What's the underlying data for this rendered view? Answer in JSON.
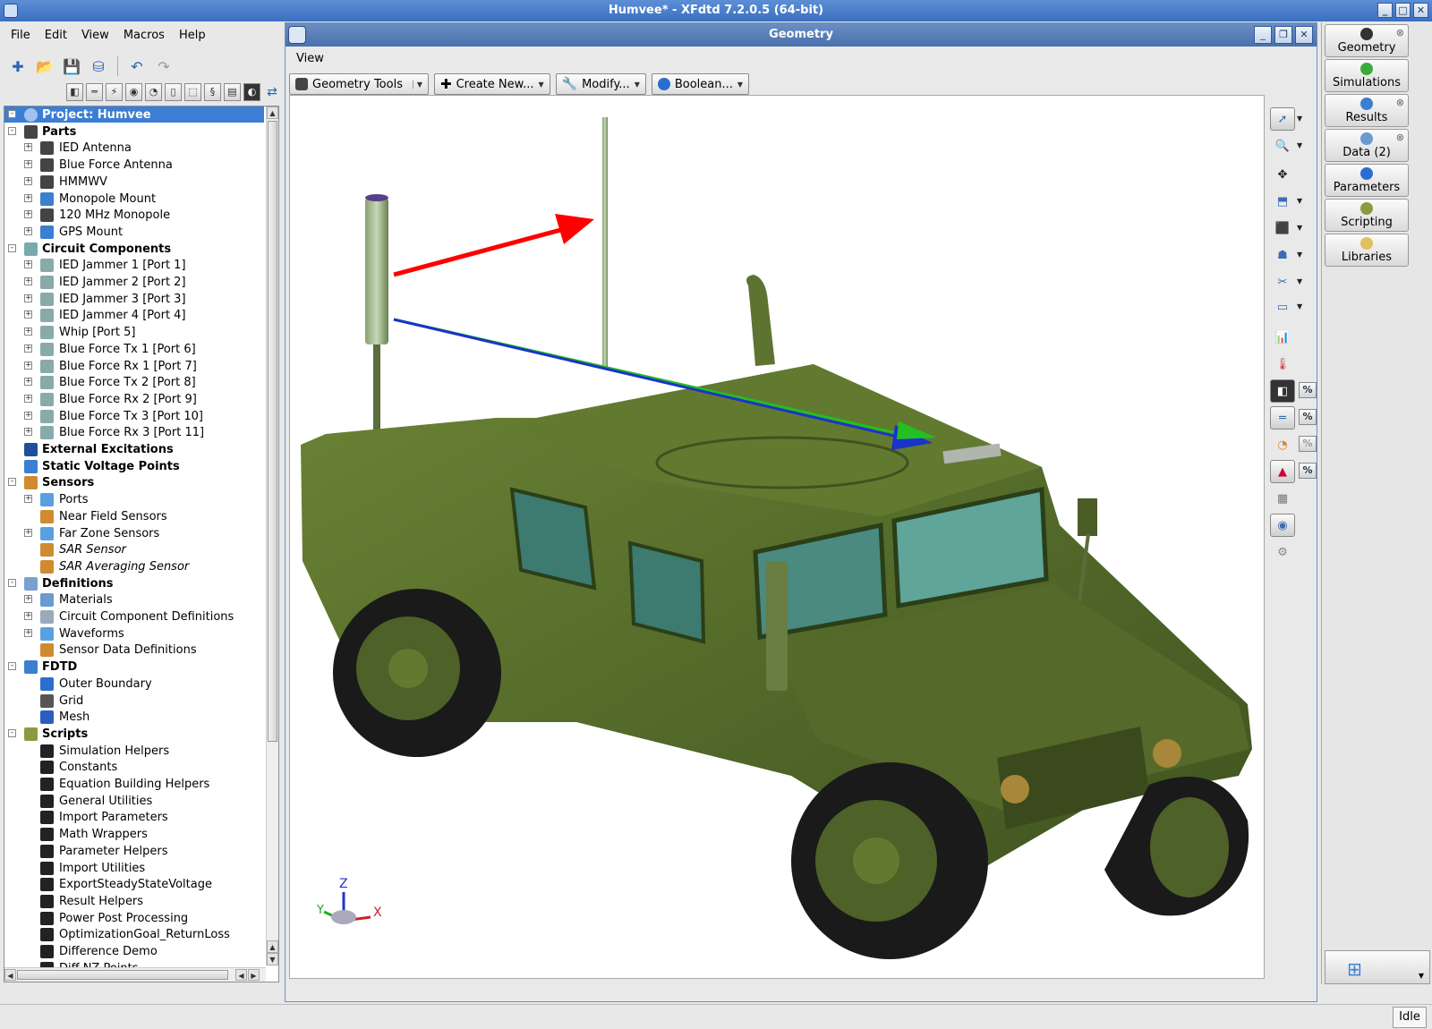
{
  "window": {
    "title": "Humvee* - XFdtd 7.2.0.5 (64-bit)"
  },
  "menu": [
    "File",
    "Edit",
    "View",
    "Macros",
    "Help"
  ],
  "tree": {
    "project": "Project: Humvee",
    "rows": [
      {
        "label": "Parts",
        "level": 1,
        "bold": true,
        "icon": "parts-icon",
        "color": "#444"
      },
      {
        "label": "IED Antenna",
        "level": 2,
        "icon": "part-icon",
        "color": "#444"
      },
      {
        "label": "Blue Force Antenna",
        "level": 2,
        "icon": "part-icon",
        "color": "#444"
      },
      {
        "label": "HMMWV",
        "level": 2,
        "icon": "part-icon",
        "color": "#444"
      },
      {
        "label": "Monopole Mount",
        "level": 2,
        "icon": "mount-icon",
        "color": "#3a7fd0"
      },
      {
        "label": "120 MHz Monopole",
        "level": 2,
        "icon": "part-icon",
        "color": "#444"
      },
      {
        "label": "GPS Mount",
        "level": 2,
        "icon": "mount-icon",
        "color": "#3a7fd0"
      },
      {
        "label": "Circuit Components",
        "level": 1,
        "bold": true,
        "icon": "circuit-icon",
        "color": "#7aa"
      },
      {
        "label": "IED Jammer 1  [Port 1]",
        "level": 2,
        "icon": "port-icon",
        "color": "#8aa"
      },
      {
        "label": "IED Jammer 2  [Port 2]",
        "level": 2,
        "icon": "port-icon",
        "color": "#8aa"
      },
      {
        "label": "IED Jammer 3  [Port 3]",
        "level": 2,
        "icon": "port-icon",
        "color": "#8aa"
      },
      {
        "label": "IED Jammer 4  [Port 4]",
        "level": 2,
        "icon": "port-icon",
        "color": "#8aa"
      },
      {
        "label": "Whip  [Port 5]",
        "level": 2,
        "icon": "port-icon",
        "color": "#8aa"
      },
      {
        "label": "Blue Force Tx 1  [Port 6]",
        "level": 2,
        "icon": "port-icon",
        "color": "#8aa"
      },
      {
        "label": "Blue Force Rx 1  [Port 7]",
        "level": 2,
        "icon": "port-icon",
        "color": "#8aa"
      },
      {
        "label": "Blue Force Tx 2  [Port 8]",
        "level": 2,
        "icon": "port-icon",
        "color": "#8aa"
      },
      {
        "label": "Blue Force Rx 2  [Port 9]",
        "level": 2,
        "icon": "port-icon",
        "color": "#8aa"
      },
      {
        "label": "Blue Force Tx 3  [Port 10]",
        "level": 2,
        "icon": "port-icon",
        "color": "#8aa"
      },
      {
        "label": "Blue Force Rx 3  [Port 11]",
        "level": 2,
        "icon": "port-icon",
        "color": "#8aa"
      },
      {
        "label": "External Excitations",
        "level": 1,
        "bold": true,
        "noexp": true,
        "icon": "lightning-icon",
        "color": "#1f4e9c"
      },
      {
        "label": "Static Voltage Points",
        "level": 1,
        "bold": true,
        "noexp": true,
        "icon": "voltage-icon",
        "color": "#3a7fd0"
      },
      {
        "label": "Sensors",
        "level": 1,
        "bold": true,
        "icon": "sensor-icon",
        "color": "#d08a30"
      },
      {
        "label": "Ports",
        "level": 2,
        "icon": "sensor-ports-icon",
        "color": "#5aa0e0"
      },
      {
        "label": "Near Field Sensors",
        "level": 2,
        "noexp": true,
        "icon": "near-field-icon",
        "color": "#d08a30"
      },
      {
        "label": "Far Zone Sensors",
        "level": 2,
        "icon": "far-zone-icon",
        "color": "#5aa0e0"
      },
      {
        "label": "SAR Sensor",
        "level": 2,
        "italic": true,
        "noexp": true,
        "icon": "sar-icon",
        "color": "#d08a30"
      },
      {
        "label": "SAR Averaging Sensor",
        "level": 2,
        "italic": true,
        "noexp": true,
        "icon": "sar-icon",
        "color": "#d08a30"
      },
      {
        "label": "Definitions",
        "level": 1,
        "bold": true,
        "icon": "definitions-icon",
        "color": "#7aa0d0"
      },
      {
        "label": "Materials",
        "level": 2,
        "icon": "materials-icon",
        "color": "#6a9ad0"
      },
      {
        "label": "Circuit Component Definitions",
        "level": 2,
        "icon": "circuit-def-icon",
        "color": "#9ab"
      },
      {
        "label": "Waveforms",
        "level": 2,
        "icon": "waveform-icon",
        "color": "#5aa0e0"
      },
      {
        "label": "Sensor Data Definitions",
        "level": 2,
        "noexp": true,
        "icon": "sensor-data-icon",
        "color": "#d08a30"
      },
      {
        "label": "FDTD",
        "level": 1,
        "bold": true,
        "icon": "fdtd-icon",
        "color": "#3a7fd0"
      },
      {
        "label": "Outer Boundary",
        "level": 2,
        "noexp": true,
        "icon": "boundary-icon",
        "color": "#2a6fd0"
      },
      {
        "label": "Grid",
        "level": 2,
        "noexp": true,
        "icon": "grid-icon",
        "color": "#555"
      },
      {
        "label": "Mesh",
        "level": 2,
        "noexp": true,
        "icon": "mesh-icon",
        "color": "#2a5fc0"
      },
      {
        "label": "Scripts",
        "level": 1,
        "bold": true,
        "icon": "scripts-icon",
        "color": "#8a9a40"
      },
      {
        "label": "Simulation Helpers",
        "level": 2,
        "noexp": true,
        "icon": "script-icon",
        "color": "#222"
      },
      {
        "label": "Constants",
        "level": 2,
        "noexp": true,
        "icon": "script-icon",
        "color": "#222"
      },
      {
        "label": "Equation Building Helpers",
        "level": 2,
        "noexp": true,
        "icon": "script-icon",
        "color": "#222"
      },
      {
        "label": "General Utilities",
        "level": 2,
        "noexp": true,
        "icon": "script-icon",
        "color": "#222"
      },
      {
        "label": "Import Parameters",
        "level": 2,
        "noexp": true,
        "icon": "gear-icon",
        "color": "#222"
      },
      {
        "label": "Math Wrappers",
        "level": 2,
        "noexp": true,
        "icon": "script-icon",
        "color": "#222"
      },
      {
        "label": "Parameter Helpers",
        "level": 2,
        "noexp": true,
        "icon": "script-icon",
        "color": "#222"
      },
      {
        "label": "Import Utilities",
        "level": 2,
        "noexp": true,
        "icon": "script-icon",
        "color": "#222"
      },
      {
        "label": "ExportSteadyStateVoltage",
        "level": 2,
        "noexp": true,
        "icon": "gear-icon",
        "color": "#222"
      },
      {
        "label": "Result Helpers",
        "level": 2,
        "noexp": true,
        "icon": "script-icon",
        "color": "#222"
      },
      {
        "label": "Power Post Processing",
        "level": 2,
        "noexp": true,
        "icon": "script-icon",
        "color": "#222"
      },
      {
        "label": "OptimizationGoal_ReturnLoss",
        "level": 2,
        "noexp": true,
        "icon": "script-icon",
        "color": "#222"
      },
      {
        "label": "Difference Demo",
        "level": 2,
        "noexp": true,
        "icon": "gear-icon",
        "color": "#222"
      },
      {
        "label": "Diff NZ Points",
        "level": 2,
        "noexp": true,
        "icon": "script-icon",
        "color": "#222"
      }
    ]
  },
  "geometry": {
    "title": "Geometry",
    "menu": "View",
    "tools": [
      {
        "label": "Geometry Tools",
        "icon": "geometry-tools-icon",
        "color": "#444"
      },
      {
        "label": "Create New...",
        "icon": "plus-icon",
        "color": "#222"
      },
      {
        "label": "Modify...",
        "icon": "wrench-icon",
        "color": "#555"
      },
      {
        "label": "Boolean...",
        "icon": "boolean-icon",
        "color": "#2a6fd0"
      }
    ]
  },
  "viewport": {
    "axis": {
      "z": "Z",
      "y": "Y",
      "x": "X"
    },
    "vehicle_color": "#556b2f",
    "arrow_colors": [
      "#ff0000",
      "#1a34c8",
      "#22c022"
    ]
  },
  "dock": {
    "tabs": [
      {
        "label": "Geometry",
        "icon": "geometry-icon",
        "color": "#333",
        "closable": true
      },
      {
        "label": "Simulations",
        "icon": "simulations-icon",
        "color": "#3cab3c"
      },
      {
        "label": "Results",
        "icon": "results-icon",
        "color": "#3a7fd0",
        "closable": true
      },
      {
        "label": "Data   (2)",
        "icon": "data-icon",
        "color": "#6a9ad0",
        "closable": true
      },
      {
        "label": "Parameters",
        "icon": "parameters-icon",
        "color": "#2a6fd0"
      },
      {
        "label": "Scripting",
        "icon": "scripting-icon",
        "color": "#8a9a40"
      },
      {
        "label": "Libraries",
        "icon": "libraries-icon",
        "color": "#e0c060"
      }
    ]
  },
  "status": {
    "state": "Idle"
  }
}
